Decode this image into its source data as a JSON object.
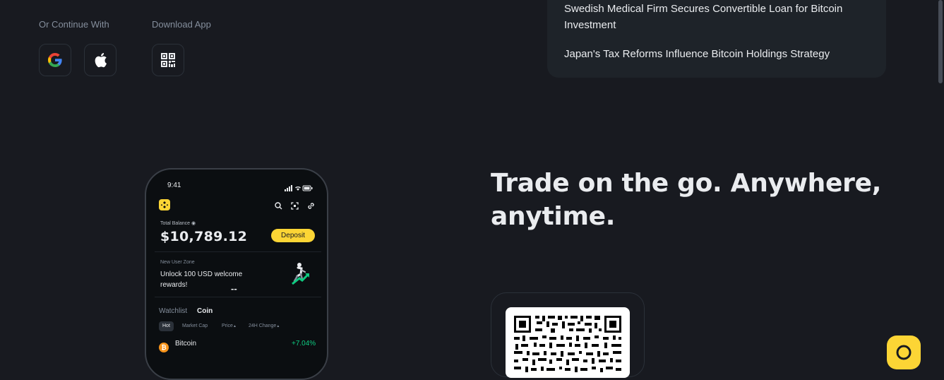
{
  "login": {
    "continue_label": "Or Continue With",
    "download_label": "Download App",
    "google_icon": "google-icon",
    "apple_icon": "apple-icon",
    "qr_icon": "qr-code-icon"
  },
  "news": {
    "items": [
      "Swedish Medical Firm Secures Convertible Loan for Bitcoin Investment",
      "Japan's Tax Reforms Influence Bitcoin Holdings Strategy"
    ]
  },
  "promo": {
    "headline": "Trade on the go. Anywhere, anytime."
  },
  "phone": {
    "time": "9:41",
    "total_balance_label": "Total Balance",
    "balance": "$10,789.12",
    "deposit_label": "Deposit",
    "new_user_zone": "New User Zone",
    "welcome_text": "Unlock 100 USD welcome rewards!",
    "dash": "--",
    "tabs": [
      "Watchlist",
      "Coin"
    ],
    "filters": [
      "Hot",
      "Market Cap",
      "Price",
      "24H Change"
    ],
    "coin_name": "Bitcoin",
    "coin_change": "+7.04%",
    "accent": "#fcd535",
    "up_color": "#0ecb81"
  }
}
